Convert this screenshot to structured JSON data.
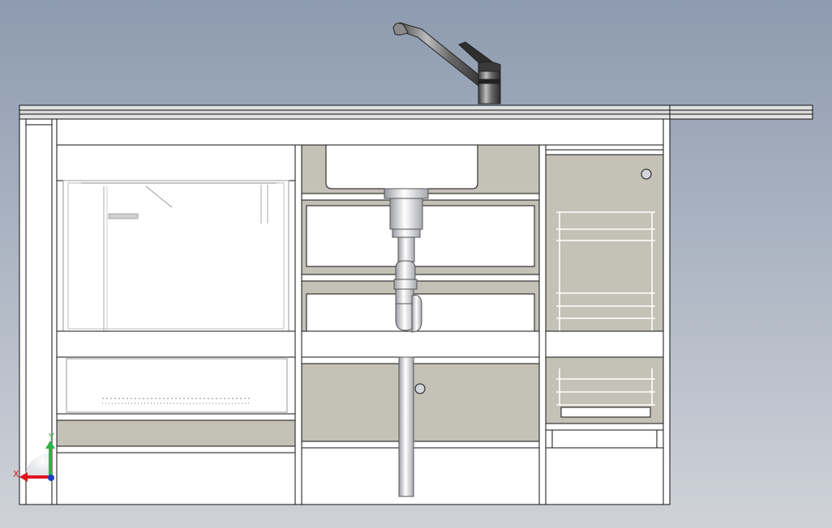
{
  "viewport": {
    "background_top": "#8d9bb0",
    "background_bottom": "#cdd0d6",
    "model_stroke": "#111111",
    "panel_white": "#ffffff",
    "panel_gray": "#c4c1b7",
    "faucet_metal": "#6e6e6e"
  },
  "triad": {
    "x_label": "X",
    "y_label": "Y",
    "x_color": "#e0141e",
    "y_color": "#2db24a",
    "z_color": "#1f3fbf"
  }
}
